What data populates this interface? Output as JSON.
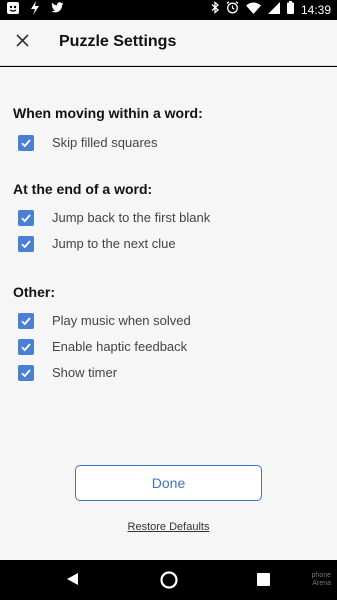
{
  "status_bar": {
    "time": "14:39",
    "icons": [
      "notification-icon",
      "flash-icon",
      "twitter-icon",
      "bluetooth-icon",
      "alarm-icon",
      "wifi-icon",
      "signal-icon",
      "battery-icon"
    ]
  },
  "header": {
    "title": "Puzzle Settings",
    "close_icon": "close-icon"
  },
  "sections": [
    {
      "title": "When moving within a word:",
      "options": [
        {
          "label": "Skip filled squares",
          "checked": true
        }
      ]
    },
    {
      "title": "At the end of a word:",
      "options": [
        {
          "label": "Jump back to the first blank",
          "checked": true
        },
        {
          "label": "Jump to the next clue",
          "checked": true
        }
      ]
    },
    {
      "title": "Other:",
      "options": [
        {
          "label": "Play music when solved",
          "checked": true
        },
        {
          "label": "Enable haptic feedback",
          "checked": true
        },
        {
          "label": "Show timer",
          "checked": true
        }
      ]
    }
  ],
  "footer": {
    "done_label": "Done",
    "restore_label": "Restore Defaults"
  },
  "watermark": {
    "line1": "phone",
    "line2": "Arena"
  },
  "colors": {
    "accent": "#3f73c9",
    "checkbox": "#4a7fd4",
    "background": "#f6f6f6"
  }
}
